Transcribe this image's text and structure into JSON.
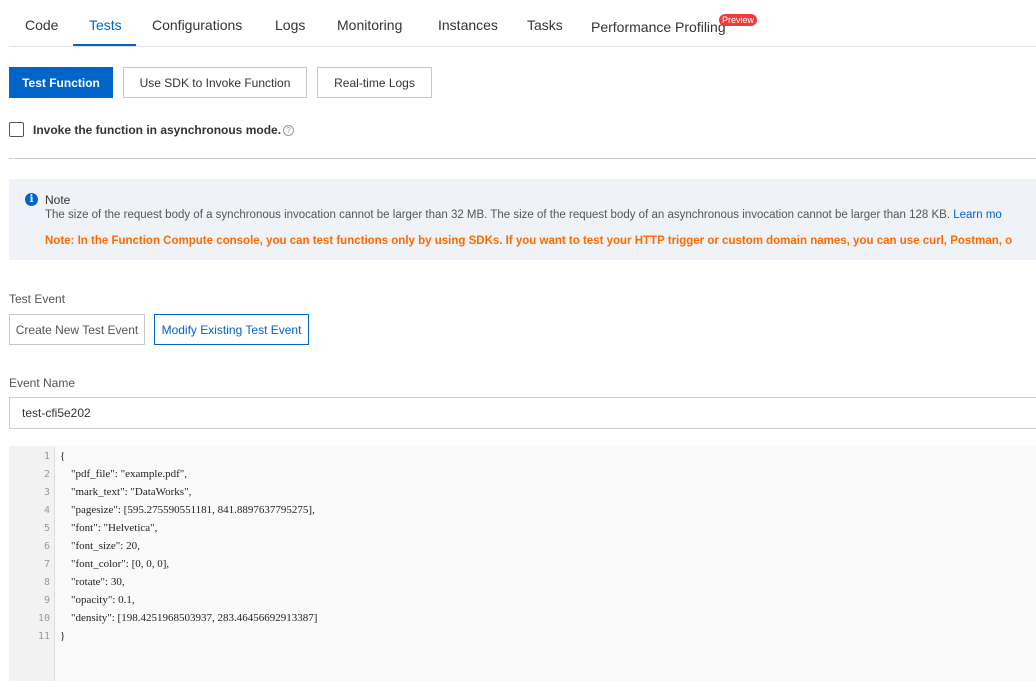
{
  "tabs": [
    {
      "label": "Code"
    },
    {
      "label": "Tests"
    },
    {
      "label": "Configurations"
    },
    {
      "label": "Logs"
    },
    {
      "label": "Monitoring"
    },
    {
      "label": "Instances"
    },
    {
      "label": "Tasks"
    },
    {
      "label": "Performance Profiling",
      "badge": "Preview"
    }
  ],
  "active_tab": "Tests",
  "toolbar": {
    "test_function": "Test Function",
    "use_sdk": "Use SDK to Invoke Function",
    "realtime_logs": "Real-time Logs"
  },
  "async": {
    "label": "Invoke the function in asynchronous mode.",
    "checked": false
  },
  "note": {
    "title": "Note",
    "text": "The size of the request body of a synchronous invocation cannot be larger than 32 MB. The size of the request body of an asynchronous invocation cannot be larger than 128 KB.",
    "link": "Learn mo",
    "warning": "Note: In the Function Compute console, you can test functions only by using SDKs. If you want to test your HTTP trigger or custom domain names, you can use curl, Postman, o"
  },
  "test_event": {
    "label": "Test Event",
    "create": "Create New Test Event",
    "modify": "Modify Existing Test Event"
  },
  "event_name": {
    "label": "Event Name",
    "value": "test-cfi5e202"
  },
  "editor": {
    "lines": [
      "{",
      "    \"pdf_file\": \"example.pdf\",",
      "    \"mark_text\": \"DataWorks\",",
      "    \"pagesize\": [595.275590551181, 841.8897637795275],",
      "    \"font\": \"Helvetica\",",
      "    \"font_size\": 20,",
      "    \"font_color\": [0, 0, 0],",
      "    \"rotate\": 30,",
      "    \"opacity\": 0.1,",
      "    \"density\": [198.4251968503937, 283.46456692913387]",
      "}"
    ]
  },
  "colors": {
    "accent": "#0064c8",
    "warning": "#ff6a00",
    "badge": "#f23c3c"
  }
}
